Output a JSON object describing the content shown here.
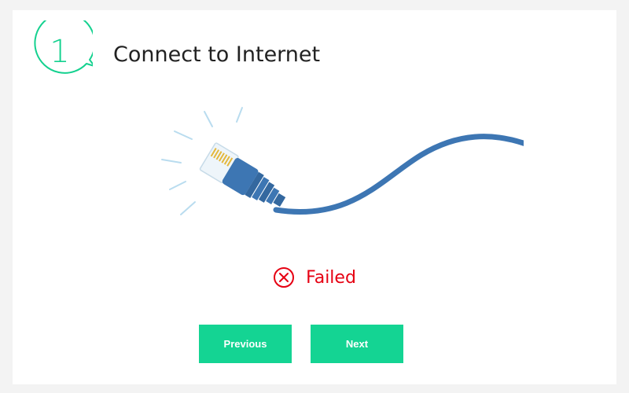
{
  "header": {
    "step_number": "1",
    "title": "Connect to Internet"
  },
  "illustration": {
    "icon": "ethernet-cable-icon"
  },
  "status": {
    "icon": "failed-x-circle-icon",
    "text": "Failed",
    "color": "#e60012"
  },
  "buttons": {
    "previous_label": "Previous",
    "next_label": "Next"
  },
  "colors": {
    "accent": "#14d493",
    "cable": "#3d76b3",
    "error": "#e60012"
  }
}
